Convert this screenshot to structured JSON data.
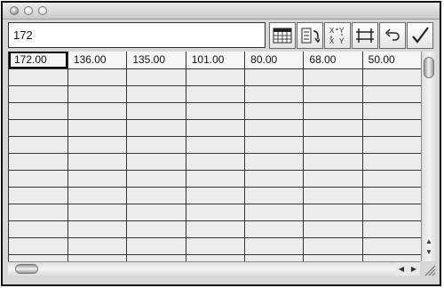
{
  "entry": {
    "value": "172"
  },
  "toolbar": {
    "buttons": [
      {
        "name": "table-view-icon"
      },
      {
        "name": "column-order-icon"
      },
      {
        "name": "transpose-icon"
      },
      {
        "name": "resize-columns-icon"
      },
      {
        "name": "undo-icon"
      },
      {
        "name": "checkmark-icon"
      }
    ]
  },
  "grid": {
    "row1": [
      "172.00",
      "136.00",
      "135.00",
      "101.00",
      "80.00",
      "68.00",
      "50.00"
    ]
  }
}
